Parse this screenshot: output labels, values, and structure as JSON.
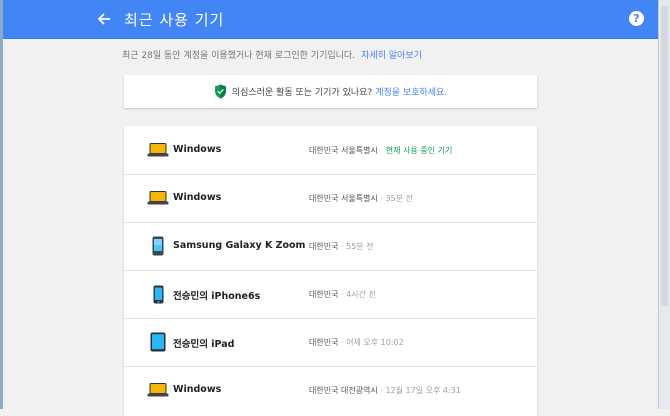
{
  "header": {
    "title": "최근 사용 기기",
    "back_icon": "arrow-left-icon",
    "help_icon": "help-circle-icon",
    "help_glyph": "?"
  },
  "colors": {
    "header_bg": "#4285f4",
    "link": "#4285f4",
    "current_device": "#0f9d58",
    "laptop": "#f4b400"
  },
  "intro": {
    "text": "최근 28일 동안 계정을 이용했거나 현재 로그인한 기기입니다.",
    "link": "자세히 알아보기"
  },
  "security": {
    "icon": "shield-check-icon",
    "question": "의심스러운 활동 또는 기기가 있나요?",
    "link": "계정을 보호하세요."
  },
  "devices": [
    {
      "icon": "laptop-icon",
      "name": "Windows",
      "location": "대한민국 서울특별시",
      "time": "",
      "current_label": "현재 사용 중인 기기"
    },
    {
      "icon": "laptop-icon",
      "name": "Windows",
      "location": "대한민국 서울특별시",
      "time": "35분 전",
      "current_label": ""
    },
    {
      "icon": "android-phone-icon",
      "name": "Samsung Galaxy K Zoom",
      "location": "대한민국",
      "time": "55분 전",
      "current_label": ""
    },
    {
      "icon": "iphone-icon",
      "name": "전승민의 iPhone6s",
      "location": "대한민국",
      "time": "4시간 전",
      "current_label": ""
    },
    {
      "icon": "ipad-icon",
      "name": "전승민의 iPad",
      "location": "대한민국",
      "time": "어제 오후 10:02",
      "current_label": ""
    },
    {
      "icon": "laptop-icon",
      "name": "Windows",
      "location": "대한민국 대전광역시",
      "time": "12월 17일 오후 4:31",
      "current_label": ""
    }
  ]
}
